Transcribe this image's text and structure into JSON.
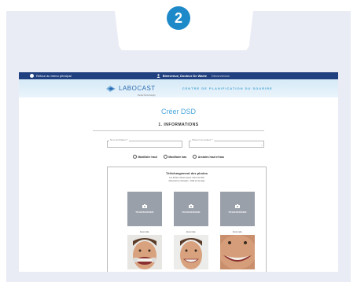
{
  "step": {
    "number": "2"
  },
  "nav": {
    "back_label": "Retour au menu principal",
    "welcome_label": "Bienvenue, Docteur De Waele",
    "logout_label": "Déconnexion"
  },
  "brand": {
    "logo_text": "LABOCAST",
    "logo_sub": "Dental Smile Design",
    "centre_label": "CENTRE DE PLANIFICATION DU SOURIRE"
  },
  "form": {
    "title": "Créer DSD",
    "section_title": "1. INFORMATIONS",
    "patient_name_placeholder": "Nom du Patient *",
    "patient_firstname_placeholder": "Prénom du patient *",
    "radio_options": [
      "Maxillaire haut",
      "Maxillaire bas",
      "Arcades haut et bas"
    ],
    "photos_legend": "Téléchargement des photos",
    "note_line1": "Les fichiers doivent peser moins de 2Mo",
    "note_line2": "Dimensions minimales : 1920 px de large",
    "upload_label": "TRANSFÉRER",
    "example_label": "Exemple"
  },
  "colors": {
    "accent": "#1d89c9",
    "nav_bg": "#1f3f7e",
    "upload_bg": "#9aa0aa",
    "outer_bg": "#e9ecf5"
  },
  "icons": [
    "step-badge",
    "back-circle-icon",
    "user-icon",
    "logo-mark-icon",
    "camera-icon"
  ]
}
